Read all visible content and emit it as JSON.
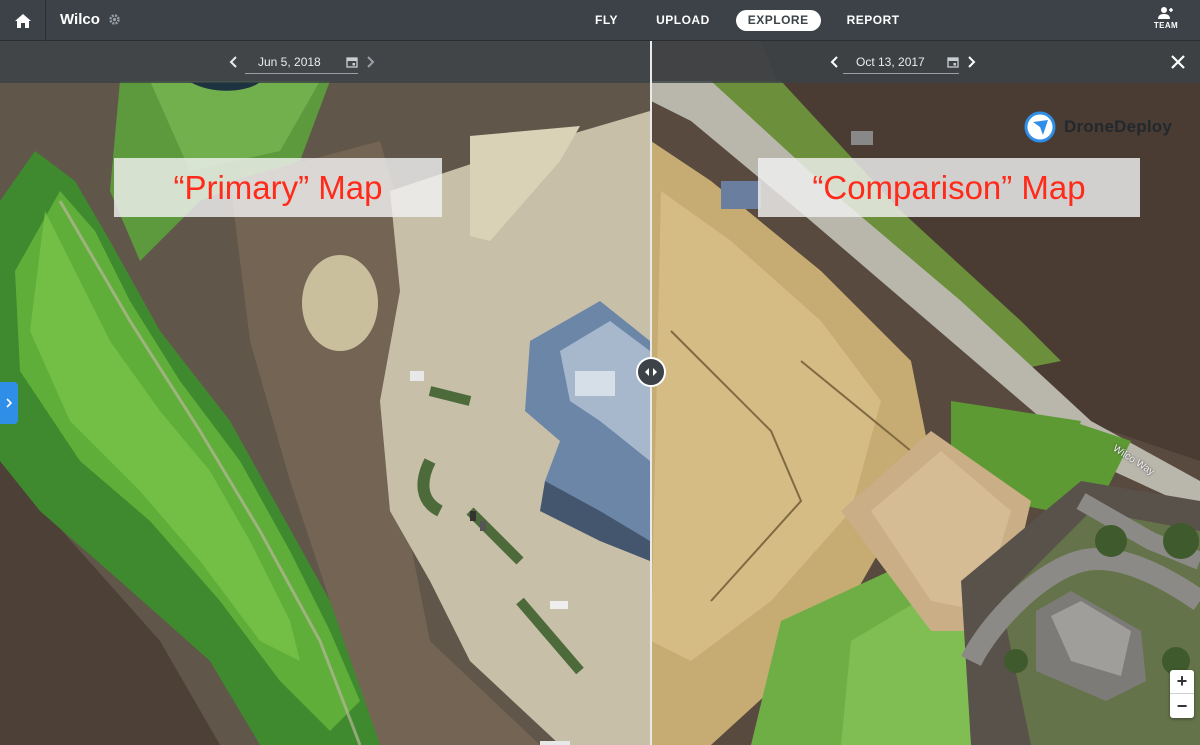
{
  "header": {
    "project_name": "Wilco",
    "nav_tabs": [
      {
        "label": "FLY",
        "active": false
      },
      {
        "label": "UPLOAD",
        "active": false
      },
      {
        "label": "EXPLORE",
        "active": true
      },
      {
        "label": "REPORT",
        "active": false
      }
    ],
    "team_label": "TEAM",
    "icons": {
      "home": "home-icon",
      "settings": "gear-icon",
      "team": "team-icon"
    }
  },
  "primary_map": {
    "date": "Jun 5, 2018",
    "annotation": "“Primary” Map"
  },
  "comparison_map": {
    "date": "Oct 13, 2017",
    "annotation": "“Comparison” Map",
    "street_label": "Wilco Way"
  },
  "logo": {
    "text": "DroneDeploy"
  },
  "zoom": {
    "in_label": "+",
    "out_label": "−"
  },
  "colors": {
    "topbar": "#3c4247",
    "accent_blue": "#2f8fe8",
    "annotation_red": "#ff2a1a",
    "active_tab_bg": "#ffffff"
  }
}
